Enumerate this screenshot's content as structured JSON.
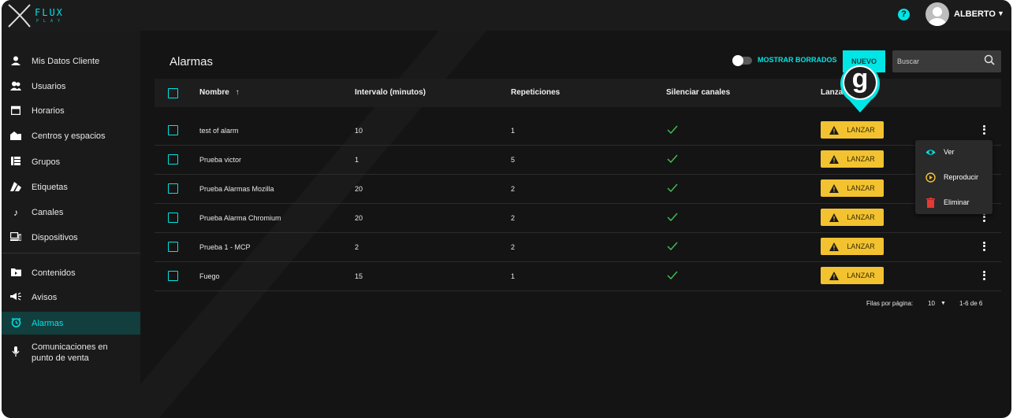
{
  "app": {
    "logo_text": "FLUX",
    "logo_sub": "PLAY"
  },
  "header": {
    "help_label": "?",
    "user_name": "ALBERTO"
  },
  "sidebar": {
    "items": [
      {
        "label": "Mis Datos Cliente",
        "icon": "person-icon"
      },
      {
        "label": "Usuarios",
        "icon": "users-icon"
      },
      {
        "label": "Horarios",
        "icon": "calendar-icon"
      },
      {
        "label": "Centros y espacios",
        "icon": "building-icon"
      },
      {
        "label": "Grupos",
        "icon": "grid-icon"
      },
      {
        "label": "Etiquetas",
        "icon": "tags-icon"
      },
      {
        "label": "Canales",
        "icon": "music-note-icon"
      },
      {
        "label": "Dispositivos",
        "icon": "devices-icon"
      },
      {
        "label": "Contenidos",
        "icon": "folder-icon"
      },
      {
        "label": "Avisos",
        "icon": "megaphone-icon"
      },
      {
        "label": "Alarmas",
        "icon": "alarm-icon",
        "active": true
      },
      {
        "label": "Comunicaciones en punto de venta",
        "icon": "microphone-icon"
      }
    ]
  },
  "page": {
    "title": "Alarmas",
    "show_deleted_label": "MOSTRAR BORRADOS",
    "new_button_label": "NUEVO",
    "search_placeholder": "Buscar"
  },
  "table": {
    "columns": [
      "Nombre",
      "Intervalo (minutos)",
      "Repeticiones",
      "Silenciar canales",
      "Lanzar"
    ],
    "sort_indicator": "↑",
    "launch_label": "LANZAR",
    "rows": [
      {
        "name": "test of alarm",
        "interval": "10",
        "repetitions": "1",
        "mute_channels": true
      },
      {
        "name": "Prueba victor",
        "interval": "1",
        "repetitions": "5",
        "mute_channels": true
      },
      {
        "name": "Prueba Alarmas Mozilla",
        "interval": "20",
        "repetitions": "2",
        "mute_channels": true
      },
      {
        "name": "Prueba Alarma Chromium",
        "interval": "20",
        "repetitions": "2",
        "mute_channels": true
      },
      {
        "name": "Prueba 1 - MCP",
        "interval": "2",
        "repetitions": "2",
        "mute_channels": true
      },
      {
        "name": "Fuego",
        "interval": "15",
        "repetitions": "1",
        "mute_channels": true
      }
    ]
  },
  "pagination": {
    "rows_per_page_label": "Filas por página:",
    "rows_per_page_value": "10",
    "range": "1-6 de 6"
  },
  "context_menu": {
    "items": [
      {
        "label": "Ver",
        "icon": "eye-icon"
      },
      {
        "label": "Reproducir",
        "icon": "play-circle-icon"
      },
      {
        "label": "Eliminar",
        "icon": "trash-icon"
      }
    ]
  },
  "marker": {
    "letter": "g"
  },
  "colors": {
    "accent": "#00e5e5",
    "launch": "#f2c230",
    "delete": "#e53935",
    "play": "#f2c230",
    "background": "#141414"
  }
}
